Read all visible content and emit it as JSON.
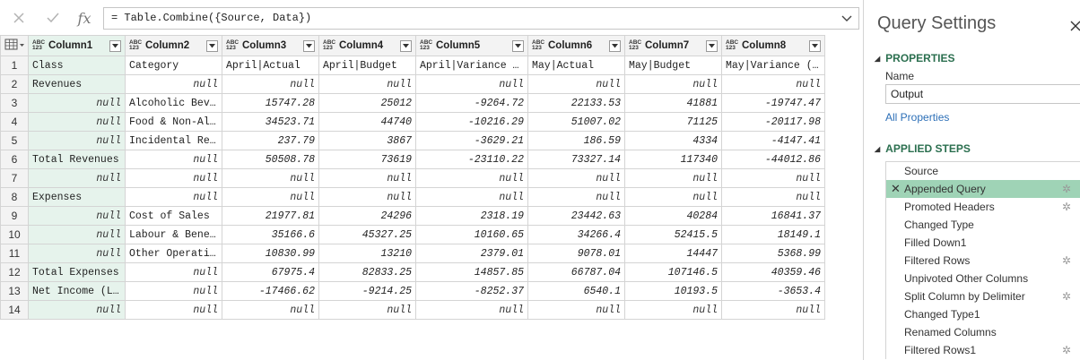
{
  "formula": {
    "text": "= Table.Combine({Source, Data})",
    "cancel_icon": "close-icon",
    "commit_icon": "check-icon",
    "fx_label": "fx"
  },
  "grid": {
    "type_badge_top": "ABC",
    "type_badge_bottom": "123",
    "columns": [
      "Column1",
      "Column2",
      "Column3",
      "Column4",
      "Column5",
      "Column6",
      "Column7",
      "Column8"
    ],
    "rows": [
      {
        "n": "1",
        "cells": [
          "Class",
          "Category",
          "April|Actual",
          "April|Budget",
          "April|Variance …",
          "May|Actual",
          "May|Budget",
          "May|Variance (…"
        ]
      },
      {
        "n": "2",
        "cells": [
          "Revenues",
          "null",
          "null",
          "null",
          "null",
          "null",
          "null",
          "null"
        ]
      },
      {
        "n": "3",
        "cells": [
          "null",
          "Alcoholic Bev…",
          "15747.28",
          "25012",
          "-9264.72",
          "22133.53",
          "41881",
          "-19747.47"
        ]
      },
      {
        "n": "4",
        "cells": [
          "null",
          "Food & Non-Al…",
          "34523.71",
          "44740",
          "-10216.29",
          "51007.02",
          "71125",
          "-20117.98"
        ]
      },
      {
        "n": "5",
        "cells": [
          "null",
          "Incidental Re…",
          "237.79",
          "3867",
          "-3629.21",
          "186.59",
          "4334",
          "-4147.41"
        ]
      },
      {
        "n": "6",
        "cells": [
          "Total Revenues",
          "null",
          "50508.78",
          "73619",
          "-23110.22",
          "73327.14",
          "117340",
          "-44012.86"
        ]
      },
      {
        "n": "7",
        "cells": [
          "null",
          "null",
          "null",
          "null",
          "null",
          "null",
          "null",
          "null"
        ]
      },
      {
        "n": "8",
        "cells": [
          "Expenses",
          "null",
          "null",
          "null",
          "null",
          "null",
          "null",
          "null"
        ]
      },
      {
        "n": "9",
        "cells": [
          "null",
          "Cost of Sales",
          "21977.81",
          "24296",
          "2318.19",
          "23442.63",
          "40284",
          "16841.37"
        ]
      },
      {
        "n": "10",
        "cells": [
          "null",
          "Labour & Bene…",
          "35166.6",
          "45327.25",
          "10160.65",
          "34266.4",
          "52415.5",
          "18149.1"
        ]
      },
      {
        "n": "11",
        "cells": [
          "null",
          "Other Operati…",
          "10830.99",
          "13210",
          "2379.01",
          "9078.01",
          "14447",
          "5368.99"
        ]
      },
      {
        "n": "12",
        "cells": [
          "Total Expenses",
          "null",
          "67975.4",
          "82833.25",
          "14857.85",
          "66787.04",
          "107146.5",
          "40359.46"
        ]
      },
      {
        "n": "13",
        "cells": [
          "Net Income (L…",
          "null",
          "-17466.62",
          "-9214.25",
          "-8252.37",
          "6540.1",
          "10193.5",
          "-3653.4"
        ]
      },
      {
        "n": "14",
        "cells": [
          "null",
          "null",
          "null",
          "null",
          "null",
          "null",
          "null",
          "null"
        ]
      }
    ]
  },
  "query_settings": {
    "title": "Query Settings",
    "properties_header": "PROPERTIES",
    "name_label": "Name",
    "name_value": "Output",
    "all_properties_link": "All Properties",
    "applied_steps_header": "APPLIED STEPS",
    "steps": [
      {
        "label": "Source",
        "active": false,
        "gear": false
      },
      {
        "label": "Appended Query",
        "active": true,
        "gear": true
      },
      {
        "label": "Promoted Headers",
        "active": false,
        "gear": true
      },
      {
        "label": "Changed Type",
        "active": false,
        "gear": false
      },
      {
        "label": "Filled Down1",
        "active": false,
        "gear": false
      },
      {
        "label": "Filtered Rows",
        "active": false,
        "gear": true
      },
      {
        "label": "Unpivoted Other Columns",
        "active": false,
        "gear": false
      },
      {
        "label": "Split Column by Delimiter",
        "active": false,
        "gear": true
      },
      {
        "label": "Changed Type1",
        "active": false,
        "gear": false
      },
      {
        "label": "Renamed Columns",
        "active": false,
        "gear": false
      },
      {
        "label": "Filtered Rows1",
        "active": false,
        "gear": true
      }
    ]
  }
}
